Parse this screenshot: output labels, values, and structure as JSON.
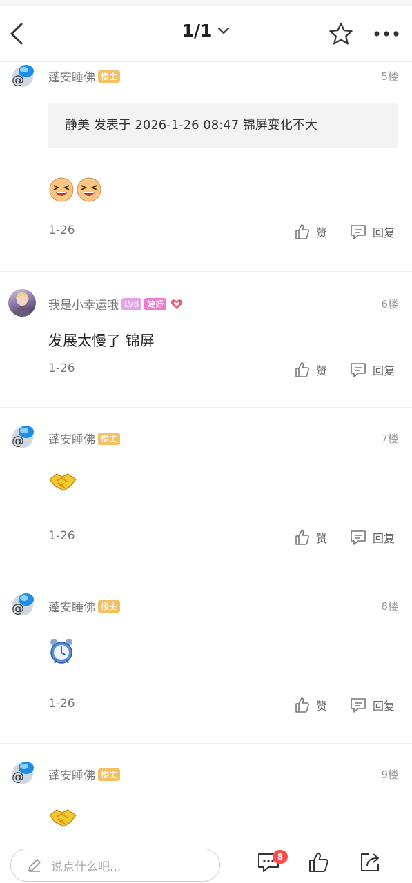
{
  "header": {
    "pager": "1/1"
  },
  "posts": [
    {
      "author": "蓬安睡佛",
      "badge": "楼主",
      "floor": "5楼",
      "quote": "静美 发表于 2026-1-26 08:47 锦屏变化不大",
      "date": "1-26",
      "like_label": "赞",
      "reply_label": "回复"
    },
    {
      "author": "我是小幸运哦",
      "level": "LV8",
      "tag": "婕妤",
      "floor": "6楼",
      "text": "发展太慢了 锦屏",
      "date": "1-26",
      "like_label": "赞",
      "reply_label": "回复"
    },
    {
      "author": "蓬安睡佛",
      "badge": "楼主",
      "floor": "7楼",
      "date": "1-26",
      "like_label": "赞",
      "reply_label": "回复"
    },
    {
      "author": "蓬安睡佛",
      "badge": "楼主",
      "floor": "8楼",
      "date": "1-26",
      "like_label": "赞",
      "reply_label": "回复"
    },
    {
      "author": "蓬安睡佛",
      "badge": "楼主",
      "floor": "9楼"
    }
  ],
  "bottom": {
    "placeholder": "说点什么吧...",
    "comment_count": "8"
  },
  "colors": {
    "owner_badge": "#f5c063",
    "level_badge": "#e4a5e8",
    "title_badge": "#ec7bd1",
    "notif": "#ff4a4a"
  }
}
